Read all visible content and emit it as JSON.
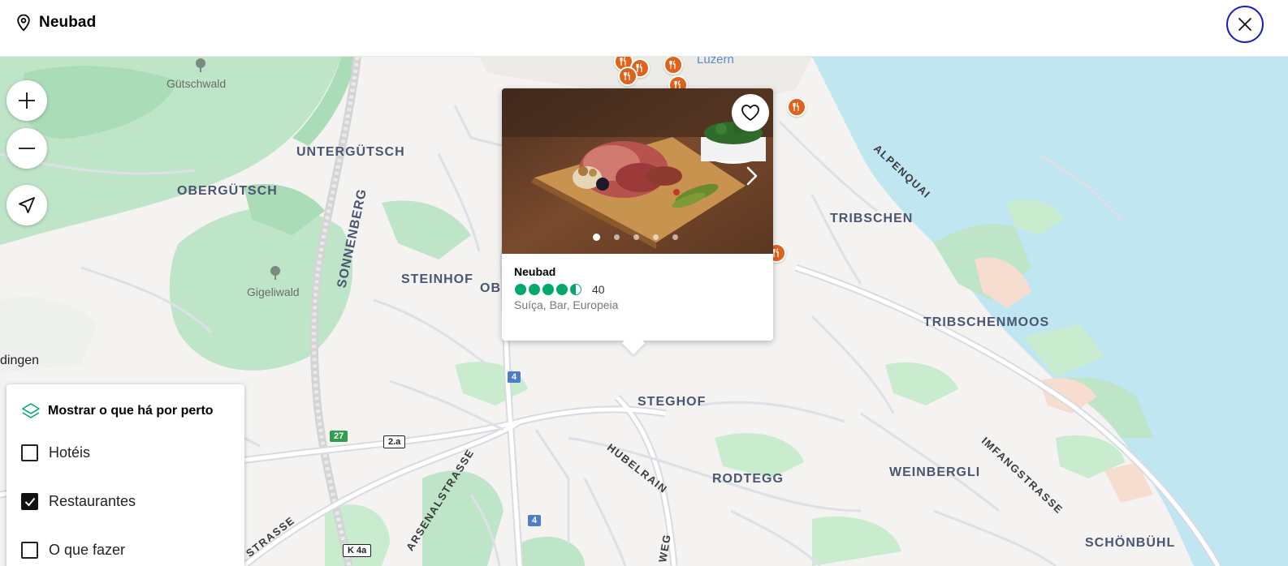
{
  "header": {
    "title": "Neubad",
    "pin_icon": "location-pin-icon",
    "close_icon": "close-icon"
  },
  "map": {
    "controls": [
      "zoom-in-icon",
      "zoom-out-icon",
      "locate-me-icon"
    ],
    "labels": {
      "gutschwald": "Gütschwald",
      "untergutsch": "UNTERGÜTSCH",
      "obergutsch": "OBERGÜTSCH",
      "sonnenberg": "SONNENBERG",
      "gigeliwald": "Gigeliwald",
      "steinhof": "STEINHOF",
      "obe": "OBE",
      "dingen": "dingen",
      "luzern": "Luzern",
      "alpenquai": "ALPENQUAI",
      "tribschen": "TRIBSCHEN",
      "tribschenmoos": "TRIBSCHENMOOS",
      "steghof": "STEGHOF",
      "hubelrain": "HUBELRAIN",
      "rodtegg": "RODTEGG",
      "weinbergli": "WEINBERGLI",
      "imfangstrasse": "IMFANGSTRASSE",
      "schonbuhl": "SCHÖNBÜHL",
      "arsenalstrasse": "ARSENALSTRASSE",
      "strasse": "STRASSE",
      "weg": "WEG"
    },
    "shields": {
      "r4a": "4",
      "r4b": "4",
      "r27": "27",
      "r2a": "2.a",
      "rk4a": "K 4a"
    },
    "accent_colors": {
      "water": "#bfe6f1",
      "park": "#bfe5c8",
      "marker": "#e0631c",
      "rating": "#00aa6c"
    }
  },
  "popup": {
    "name": "Neubad",
    "rating": 4.5,
    "review_count": "40",
    "cuisine": "Suíça, Bar, Europeia",
    "photo_count": 5,
    "active_photo": 1
  },
  "nearby": {
    "title": "Mostrar o que há por perto",
    "options": [
      {
        "label": "Hotéis",
        "checked": false
      },
      {
        "label": "Restaurantes",
        "checked": true
      },
      {
        "label": "O que fazer",
        "checked": false
      }
    ]
  }
}
